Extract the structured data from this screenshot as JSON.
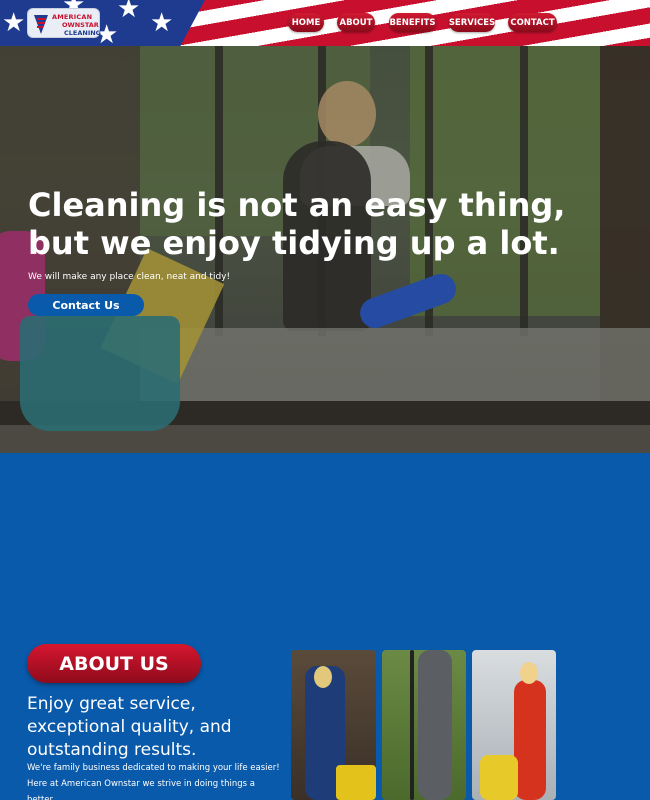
{
  "logo": {
    "line1": "AMERICAN",
    "line2": "OWNSTAR",
    "line3": "CLEANING"
  },
  "nav": {
    "items": [
      "HOME",
      "ABOUT",
      "BENEFITS",
      "SERVICES",
      "CONTACT"
    ]
  },
  "hero": {
    "headline": "Cleaning is not an easy thing, but we enjoy tidying up a lot.",
    "subtext": "We will make any place clean, neat and tidy!",
    "cta_label": "Contact Us"
  },
  "about": {
    "badge": "ABOUT US",
    "tagline": "Enjoy great service, exceptional quality, and outstanding results.",
    "body": "We're family business dedicated to making your life easier! Here at American Ownstar we strive in doing things a better"
  },
  "colors": {
    "brand_blue": "#0a5aab",
    "brand_red": "#c8102e",
    "flag_blue": "#1f3b8f"
  }
}
